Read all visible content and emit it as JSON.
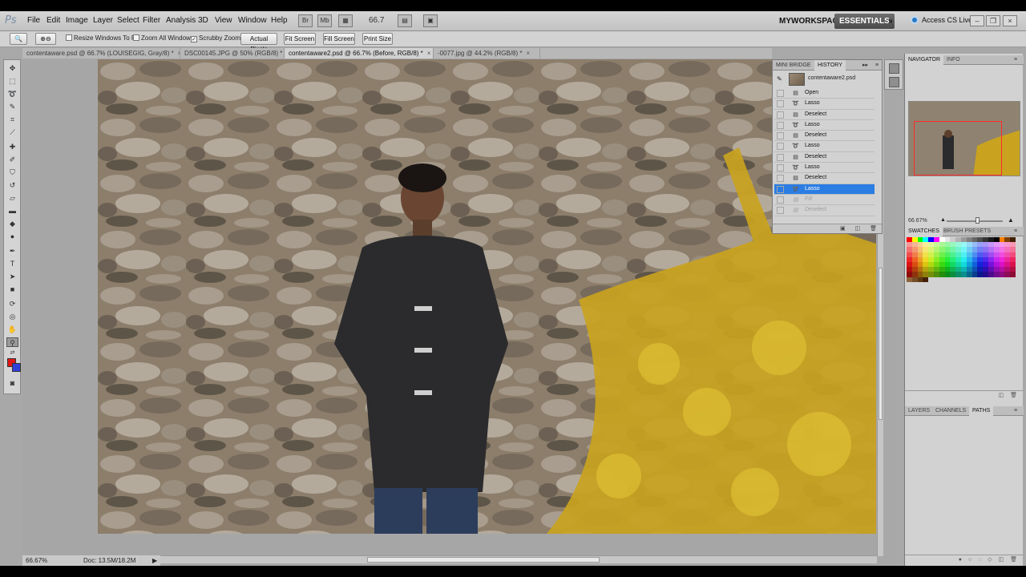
{
  "app": {
    "logo": "Ps",
    "menu": [
      "File",
      "Edit",
      "Image",
      "Layer",
      "Select",
      "Filter",
      "Analysis",
      "3D",
      "View",
      "Window",
      "Help"
    ],
    "zoom_field": "66.7",
    "workspace_left": "MYWORKSPACE",
    "workspace_active": "ESSENTIALS",
    "more_arrow": "»",
    "cs_live": "Access CS Live"
  },
  "options": {
    "resize_windows": "Resize Windows To Fit",
    "zoom_all": "Zoom All Windows",
    "scrubby_zoom": "Scrubby Zoom",
    "actual_pixels": "Actual Pixels",
    "fit_screen": "Fit Screen",
    "fill_screen": "Fill Screen",
    "print_size": "Print Size"
  },
  "tabs": [
    {
      "label": "contentaware.psd @ 66.7% (LOUISEGIG, Gray/8) *"
    },
    {
      "label": "DSC00145.JPG @ 50% (RGB/8) *"
    },
    {
      "label": "contentaware2.psd @ 66.7% (Before, RGB/8) *"
    },
    {
      "label": "-0077.jpg @ 44.2% (RGB/8) *"
    }
  ],
  "tab_close": "×",
  "status": {
    "zoom": "66.67%",
    "doc": "Doc: 13.5M/18.2M"
  },
  "history_panel": {
    "tab_bridge": "MINI BRIDGE",
    "tab_history": "HISTORY",
    "snapshot": "contentaware2.psd",
    "rows": [
      {
        "label": "Open",
        "state": "normal"
      },
      {
        "label": "Lasso",
        "state": "normal"
      },
      {
        "label": "Deselect",
        "state": "normal"
      },
      {
        "label": "Lasso",
        "state": "normal"
      },
      {
        "label": "Deselect",
        "state": "normal"
      },
      {
        "label": "Lasso",
        "state": "normal"
      },
      {
        "label": "Deselect",
        "state": "normal"
      },
      {
        "label": "Lasso",
        "state": "normal"
      },
      {
        "label": "Deselect",
        "state": "normal"
      },
      {
        "label": "Lasso",
        "state": "selected"
      },
      {
        "label": "Fill",
        "state": "dimmed"
      },
      {
        "label": "Deselect",
        "state": "dimmed"
      }
    ]
  },
  "navigator": {
    "tab_navigator": "NAVIGATOR",
    "tab_info": "INFO",
    "zoom": "66.67%"
  },
  "swatches": {
    "tab_swatches": "SWATCHES",
    "tab_brush": "BRUSH PRESETS"
  },
  "layers": {
    "tab_layers": "LAYERS",
    "tab_channels": "CHANNELS",
    "tab_paths": "PATHS"
  }
}
